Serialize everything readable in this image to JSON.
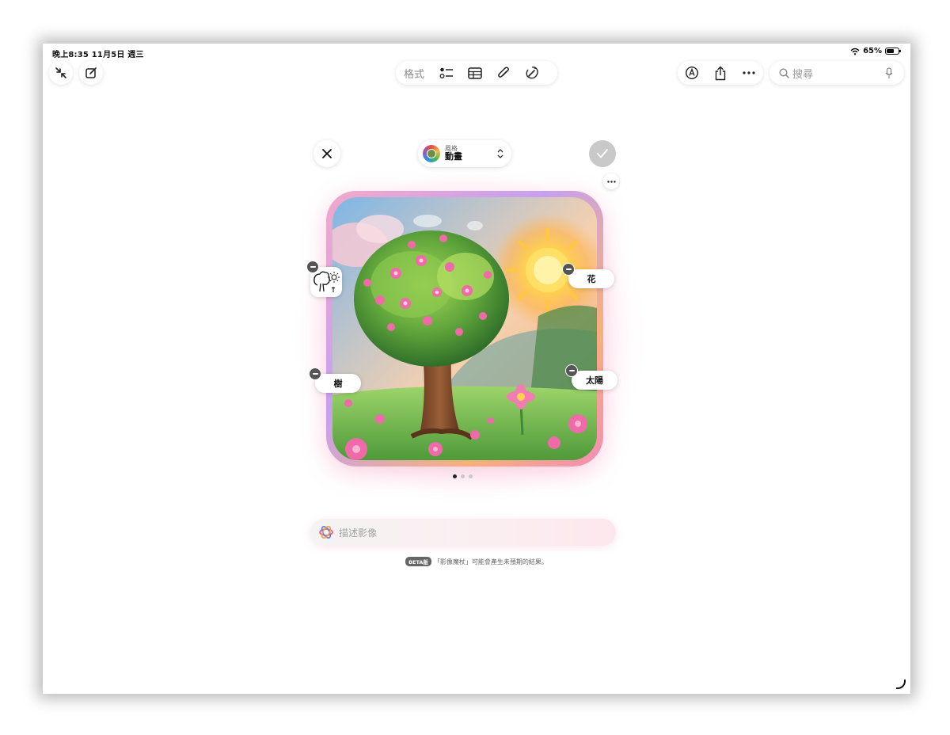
{
  "status_bar": {
    "time_date": "晚上8:35  11月5日 週三",
    "battery": "65%",
    "battery_level": 0.65
  },
  "toolbar": {
    "left": [
      {
        "icon": "collapse-arrows-icon"
      },
      {
        "icon": "compose-icon"
      }
    ],
    "format_label": "格式",
    "center_icons": [
      "checklist-icon",
      "table-icon",
      "paperclip-icon",
      "magic-pen-icon"
    ],
    "right_icons": [
      "markup-icon",
      "share-icon",
      "more-icon"
    ],
    "search_placeholder": "搜尋"
  },
  "playground": {
    "style_small": "風格",
    "style_name": "動畫",
    "concepts": {
      "flower": "花",
      "tree": "樹",
      "sun": "太陽"
    },
    "page_count": 3,
    "current_page": 1,
    "prompt_placeholder": "描述影像",
    "beta_label": "BETA版",
    "disclaimer": "「影像魔杖」可能會產生未預期的結果。"
  },
  "colors": {
    "accent_pink": "#f28db8",
    "done_disabled": "#c9c9c9"
  }
}
